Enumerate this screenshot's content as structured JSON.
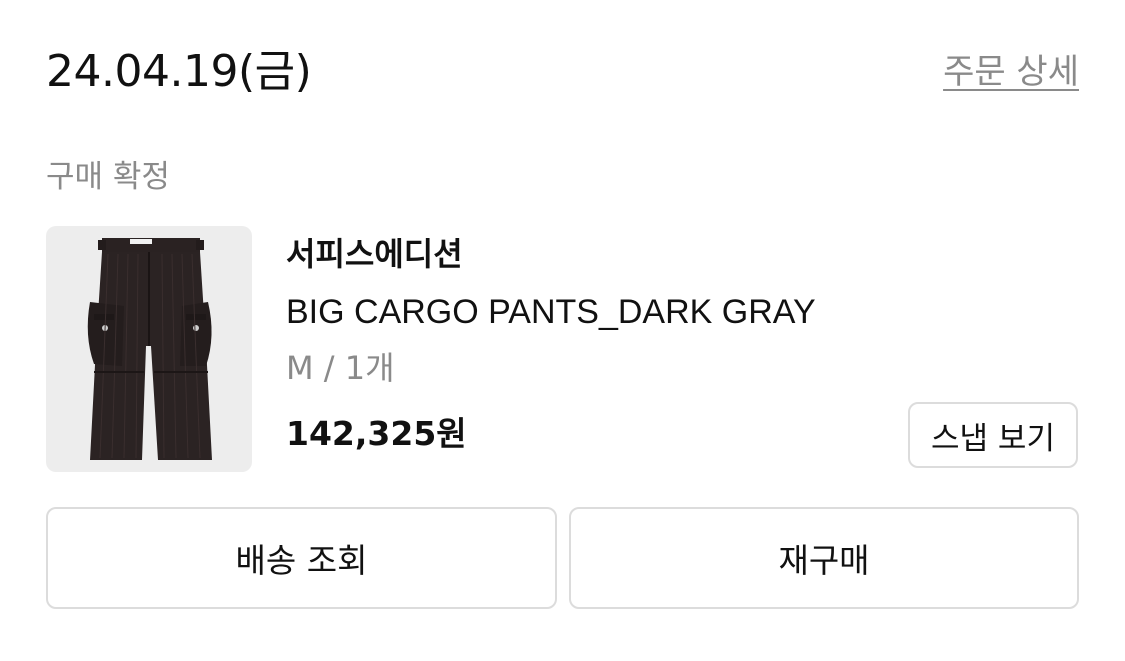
{
  "order": {
    "date": "24.04.19(금)",
    "detail_link": "주문 상세",
    "status": "구매 확정"
  },
  "product": {
    "image_icon": "cargo-pants-product-photo",
    "brand": "서피스에디션",
    "name": "BIG CARGO PANTS_DARK GRAY",
    "option": "M / 1개",
    "price": "142,325원"
  },
  "buttons": {
    "snap": "스냅 보기",
    "track_delivery": "배송 조회",
    "reorder": "재구매"
  },
  "colors": {
    "primary_text": "#111111",
    "secondary_text": "#8a8a8a",
    "border": "#dcdcdc",
    "thumb_background": "#ededed",
    "pants": "#2a2222"
  }
}
